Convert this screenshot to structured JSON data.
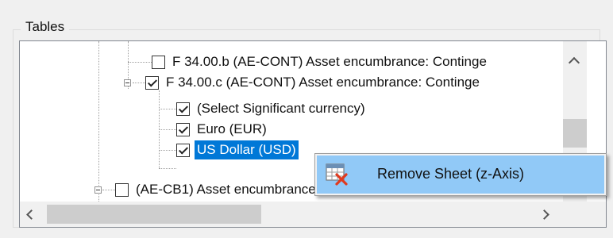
{
  "group": {
    "title": "Tables"
  },
  "tree": {
    "rows": [
      {
        "label": "F 34.00.b (AE-CONT) Asset encumbrance: Continge",
        "checked": false,
        "selected": false
      },
      {
        "label": "F 34.00.c (AE-CONT) Asset encumbrance: Continge",
        "checked": true,
        "selected": false
      },
      {
        "label": "(Select Significant currency)",
        "checked": true,
        "selected": false
      },
      {
        "label": "Euro (EUR)",
        "checked": true,
        "selected": false
      },
      {
        "label": "US Dollar (USD)",
        "checked": true,
        "selected": true
      },
      {
        "label": "(AE-CB1) Asset encumbrance",
        "checked": false,
        "selected": false
      }
    ]
  },
  "context_menu": {
    "items": [
      {
        "label": "Remove Sheet (z-Axis)",
        "icon": "remove-sheet-icon"
      }
    ]
  },
  "colors": {
    "selection": "#0078d7",
    "menu_highlight": "#91c9f7"
  }
}
